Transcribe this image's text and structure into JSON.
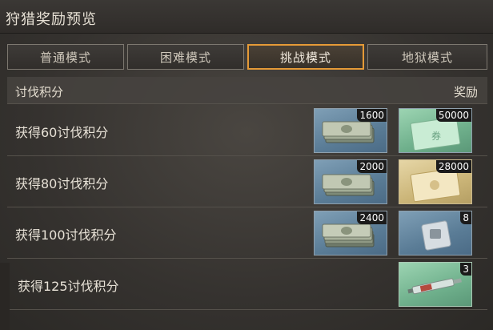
{
  "title": "狩猎奖励预览",
  "tabs": [
    {
      "label": "普通模式",
      "active": false
    },
    {
      "label": "困难模式",
      "active": false
    },
    {
      "label": "挑战模式",
      "active": true
    },
    {
      "label": "地狱模式",
      "active": false
    }
  ],
  "header": {
    "left": "讨伐积分",
    "right": "奖励"
  },
  "rows": [
    {
      "label": "获得60讨伐积分",
      "rewards": [
        {
          "icon": "cash-stack-icon",
          "count": "1600",
          "bg": "blue"
        },
        {
          "icon": "green-banknote-icon",
          "count": "50000",
          "bg": "green"
        }
      ]
    },
    {
      "label": "获得80讨伐积分",
      "rewards": [
        {
          "icon": "cash-stack-icon",
          "count": "2000",
          "bg": "blue"
        },
        {
          "icon": "gold-banknote-icon",
          "count": "28000",
          "bg": "green"
        }
      ]
    },
    {
      "label": "获得100讨伐积分",
      "rewards": [
        {
          "icon": "cash-stack-icon",
          "count": "2400",
          "bg": "blue"
        },
        {
          "icon": "item-pouch-icon",
          "count": "8",
          "bg": "blue"
        }
      ]
    },
    {
      "label": "获得125讨伐积分",
      "rewards": [
        {
          "icon": "syringe-icon",
          "count": "3",
          "bg": "green"
        }
      ]
    }
  ],
  "colors": {
    "active_tab_border": "#e59a37",
    "rare_bg": "#6fb08c",
    "common_bg": "#5a7c96"
  }
}
